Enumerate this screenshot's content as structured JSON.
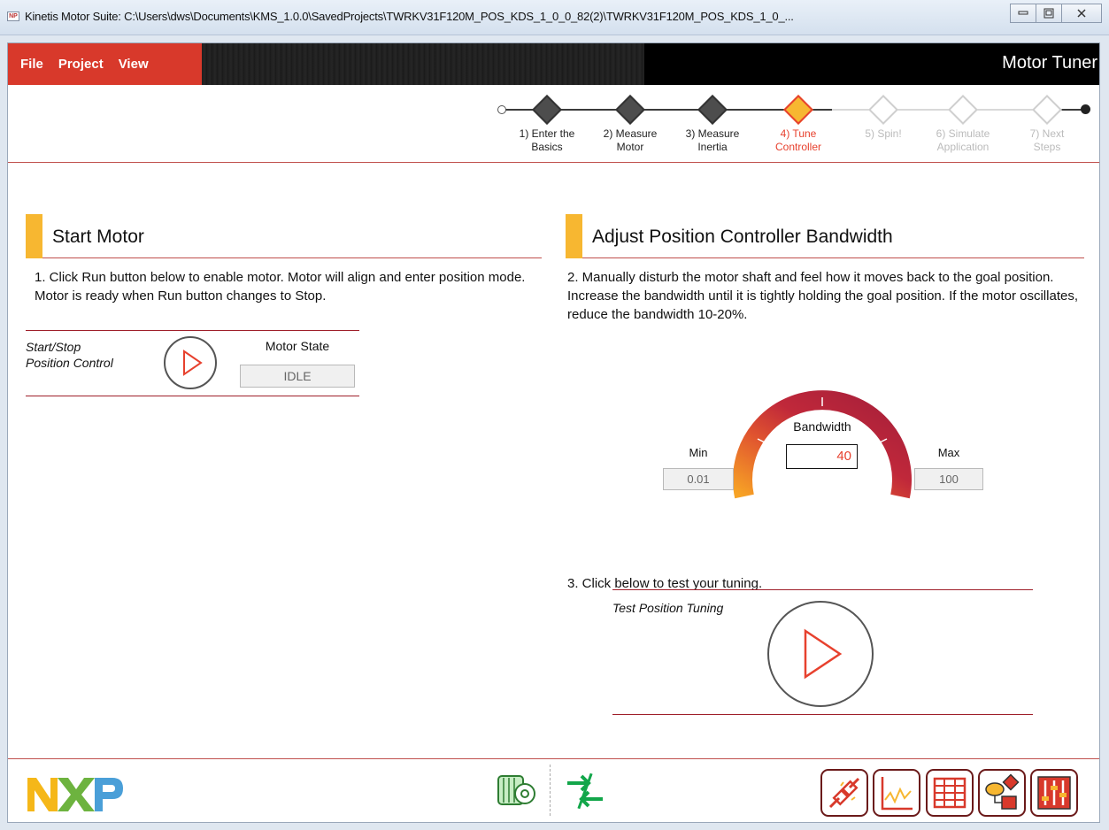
{
  "window": {
    "app_icon": "NP",
    "title": "Kinetis Motor Suite: C:\\Users\\dws\\Documents\\KMS_1.0.0\\SavedProjects\\TWRKV31F120M_POS_KDS_1_0_0_82(2)\\TWRKV31F120M_POS_KDS_1_0_..."
  },
  "menu": {
    "items": [
      "File",
      "Project",
      "View"
    ],
    "app_title": "Motor Tuner"
  },
  "steps": [
    {
      "line1": "1) Enter the",
      "line2": "Basics",
      "state": "done"
    },
    {
      "line1": "2) Measure",
      "line2": "Motor",
      "state": "done"
    },
    {
      "line1": "3) Measure",
      "line2": "Inertia",
      "state": "done"
    },
    {
      "line1": "4) Tune",
      "line2": "Controller",
      "state": "active"
    },
    {
      "line1": "5) Spin!",
      "line2": "",
      "state": "todo"
    },
    {
      "line1": "6) Simulate",
      "line2": "Application",
      "state": "todo"
    },
    {
      "line1": "7) Next",
      "line2": "Steps",
      "state": "todo"
    }
  ],
  "start_motor": {
    "title": "Start Motor",
    "instruction": "1. Click Run button below to enable motor. Motor will align and enter position mode. Motor is ready when Run button changes to Stop.",
    "control_label_1": "Start/Stop",
    "control_label_2": "Position Control",
    "state_label": "Motor State",
    "state_value": "IDLE"
  },
  "bandwidth": {
    "title": "Adjust Position Controller Bandwidth",
    "instruction": "2. Manually disturb the motor shaft and feel how it moves back to the goal position. Increase the bandwidth until it is tightly holding the goal position. If the motor oscillates, reduce the bandwidth 10-20%.",
    "gauge_label": "Bandwidth",
    "value": "40",
    "min_label": "Min",
    "min_value": "0.01",
    "max_label": "Max",
    "max_value": "100"
  },
  "test": {
    "instruction": "3. Click below to test your tuning.",
    "label": "Test Position Tuning"
  },
  "footer": {
    "logo": "NXP",
    "status_icons": [
      "motor-icon",
      "connection-arrows-icon"
    ],
    "tools": [
      "plug-connect-icon",
      "scope-chart-icon",
      "table-grid-icon",
      "diagram-blocks-icon",
      "sliders-icon"
    ]
  },
  "colors": {
    "accent_red": "#d8392b",
    "step_active": "#e7412e",
    "section_bar": "#f7b731",
    "divider": "#c0504d"
  }
}
